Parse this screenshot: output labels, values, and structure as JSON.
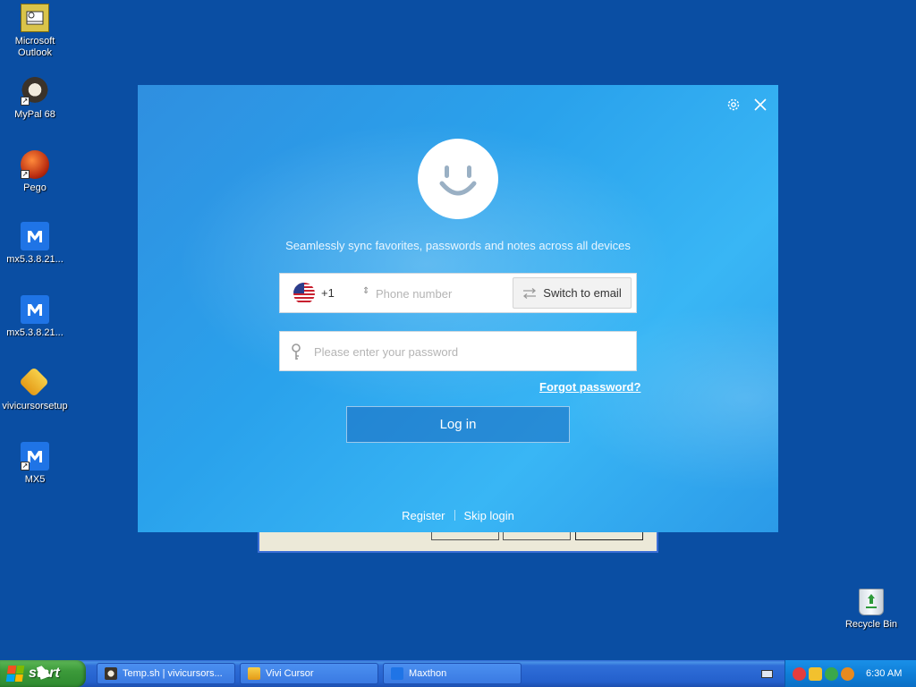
{
  "desktop": {
    "icons": [
      {
        "label": "Microsoft Outlook",
        "icon": "outlook-icon"
      },
      {
        "label": "MyPal 68",
        "icon": "raccoon-icon"
      },
      {
        "label": "Pego",
        "icon": "pego-icon"
      },
      {
        "label": "mx5.3.8.21...",
        "icon": "maxthon-icon"
      },
      {
        "label": "mx5.3.8.21...",
        "icon": "maxthon-icon"
      },
      {
        "label": "vivicursorsetup",
        "icon": "vivicursor-icon"
      },
      {
        "label": "MX5",
        "icon": "maxthon-icon"
      }
    ],
    "recycle_bin": {
      "label": "Recycle Bin",
      "icon": "recycle-bin-icon"
    }
  },
  "login": {
    "tagline": "Seamlessly sync favorites, passwords and notes across all devices",
    "country_code": "+1",
    "phone_placeholder": "Phone number",
    "switch_label": "Switch to email",
    "password_placeholder": "Please enter your password",
    "forgot_label": "Forgot password?",
    "login_label": "Log in",
    "register_label": "Register",
    "skip_label": "Skip login",
    "icons": [
      "settings-icon",
      "close-icon",
      "smiley-avatar-icon",
      "us-flag-icon",
      "key-icon",
      "swap-icon"
    ]
  },
  "taskbar": {
    "start_label": "start",
    "buttons": [
      {
        "label": "Temp.sh | vivicursors...",
        "icon": "raccoon-icon"
      },
      {
        "label": "Vivi Cursor",
        "icon": "vivicursor-icon"
      },
      {
        "label": "Maxthon",
        "icon": "maxthon-icon"
      }
    ],
    "clock": "6:30 AM"
  },
  "colors": {
    "desktop_bg": "#0a4ea3",
    "dialog_blue": "#2aa2ec",
    "taskbar_blue": "#2460cc",
    "start_green": "#3c9a3a"
  }
}
